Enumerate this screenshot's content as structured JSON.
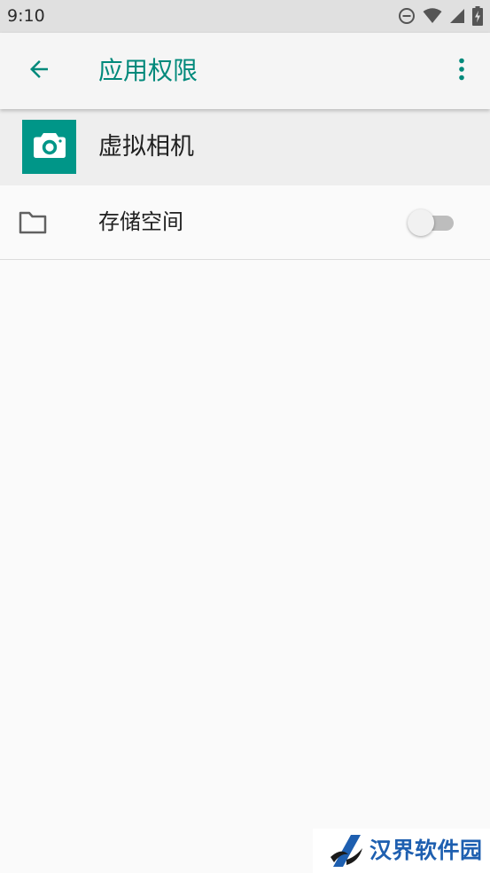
{
  "status_bar": {
    "time": "9:10",
    "icons": [
      "do-not-disturb-icon",
      "wifi-icon",
      "cell-signal-icon",
      "battery-charging-icon"
    ]
  },
  "app_bar": {
    "title": "应用权限",
    "back_icon": "arrow-back-icon",
    "overflow_icon": "more-vert-icon"
  },
  "app_header": {
    "icon": "camera-icon",
    "name": "虚拟相机"
  },
  "permissions": [
    {
      "icon": "folder-icon",
      "label": "存储空间",
      "enabled": false
    }
  ],
  "watermark": {
    "text": "汉界软件园"
  },
  "colors": {
    "accent": "#00897b",
    "app_icon_bg": "#009688",
    "status_bar_bg": "#e0e0e0",
    "app_bar_bg": "#f5f5f5",
    "header_bg": "#eeeeee",
    "page_bg": "#fafafa",
    "watermark_text": "#1e5fb0"
  }
}
